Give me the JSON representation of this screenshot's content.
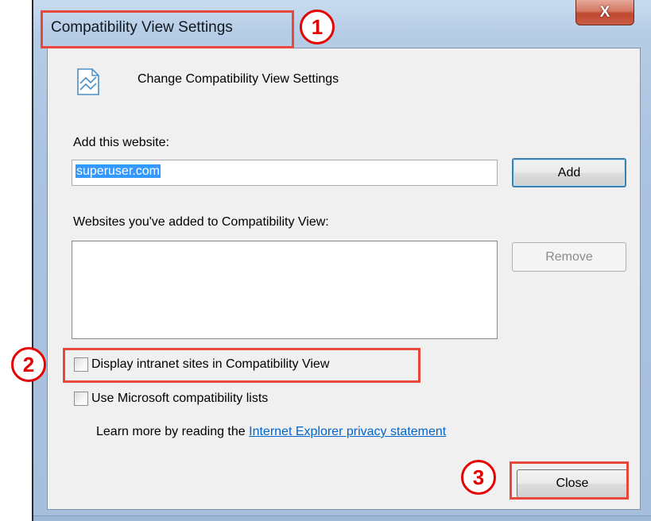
{
  "window": {
    "title": "Compatibility View Settings",
    "close_glyph": "X"
  },
  "dialog": {
    "heading": "Change Compatibility View Settings",
    "add_label": "Add this website:",
    "add_input_value": "superuser.com",
    "add_button": "Add",
    "list_label": "Websites you've added to Compatibility View:",
    "added_sites": [],
    "remove_button": "Remove",
    "checkbox_intranet": {
      "label": "Display intranet sites in Compatibility View",
      "checked": false
    },
    "checkbox_mslists": {
      "label": "Use Microsoft compatibility lists",
      "checked": false
    },
    "learn_prefix": "Learn more by reading the ",
    "privacy_link": "Internet Explorer privacy statement",
    "close_button": "Close"
  },
  "annotations": {
    "step1": "1",
    "step2": "2",
    "step3": "3",
    "color": "#e8473b"
  }
}
